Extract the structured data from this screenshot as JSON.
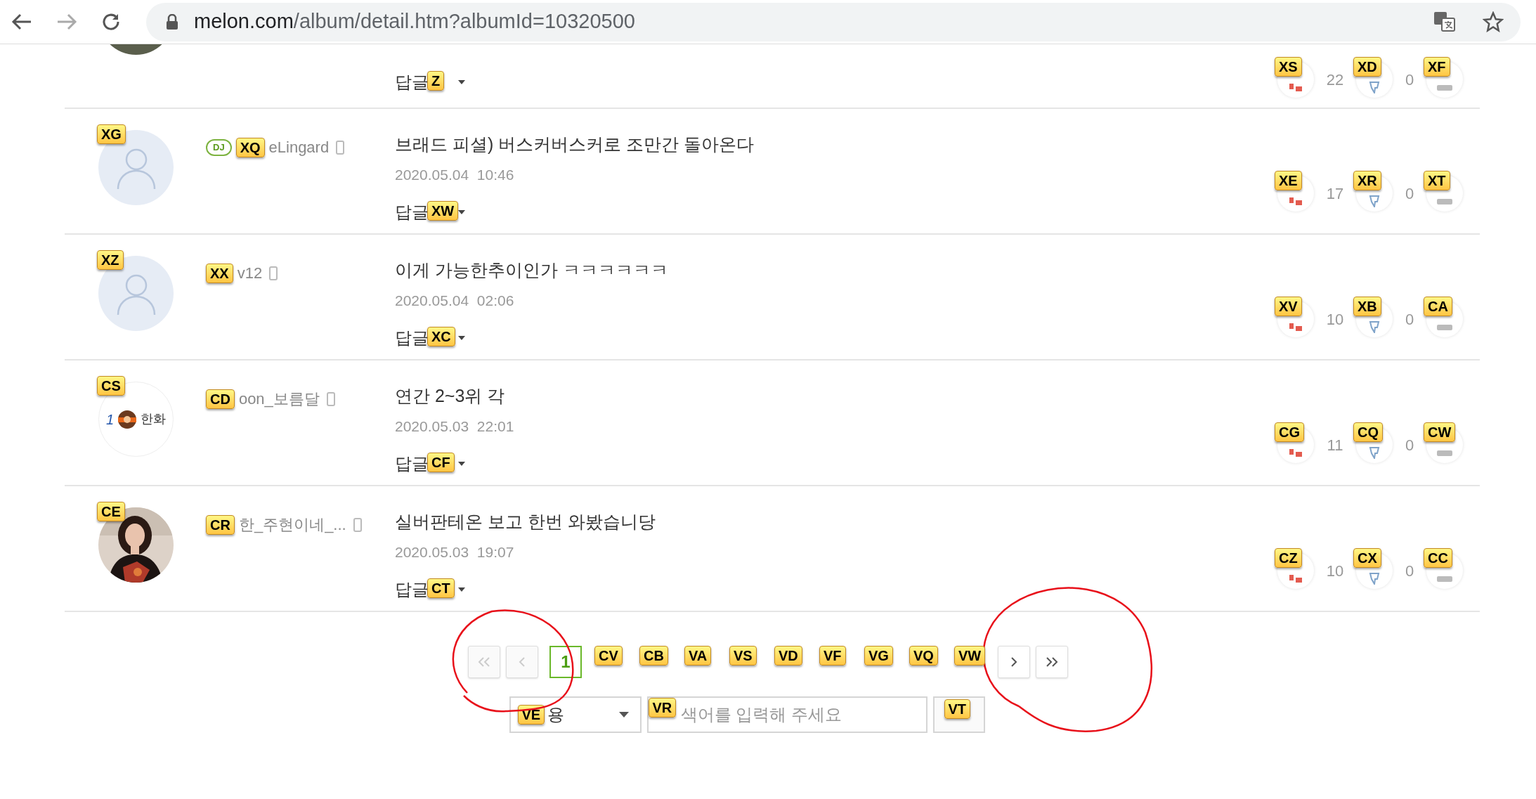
{
  "browser": {
    "url_host": "melon.com",
    "url_path": "/album/detail.htm?albumId=10320500"
  },
  "top_comment": {
    "reply": "답글",
    "hints": {
      "reply": "Z",
      "like": "XS",
      "dislike": "XD",
      "report": "XF"
    },
    "likes": "22",
    "dislikes": "0"
  },
  "comments": [
    {
      "kind": "placeholder",
      "dj": true,
      "dj_label": "DJ",
      "name": "eLingard",
      "comment": "브래드 피셜) 버스커버스커로 조만간 돌아온다",
      "date": "2020.05.04",
      "time": "10:46",
      "reply": "답글",
      "likes": "17",
      "dislikes": "0",
      "hints": {
        "avatar": "XG",
        "name": "XQ",
        "reply": "XW",
        "like": "XE",
        "dislike": "XR",
        "report": "XT"
      }
    },
    {
      "kind": "placeholder",
      "dj": false,
      "name": "v12",
      "comment": "이게 가능한추이인가 ㅋㅋㅋㅋㅋㅋ",
      "date": "2020.05.04",
      "time": "02:06",
      "reply": "답글",
      "likes": "10",
      "dislikes": "0",
      "hints": {
        "avatar": "XZ",
        "name": "XX",
        "reply": "XC",
        "like": "XV",
        "dislike": "XB",
        "report": "CA"
      }
    },
    {
      "kind": "logo",
      "avatar_texts": [
        "1",
        "한화"
      ],
      "dj": false,
      "name": "oon_보름달",
      "comment": "연간 2~3위 각",
      "date": "2020.05.03",
      "time": "22:01",
      "reply": "답글",
      "likes": "11",
      "dislikes": "0",
      "hints": {
        "avatar": "CS",
        "name": "CD",
        "reply": "CF",
        "like": "CG",
        "dislike": "CQ",
        "report": "CW"
      }
    },
    {
      "dj": false,
      "name": "한_주현이네_...",
      "comment": "실버판테온 보고 한번 와봤습니당",
      "date": "2020.05.03",
      "time": "19:07",
      "reply": "답글",
      "likes": "10",
      "dislikes": "0",
      "hints": {
        "avatar": "CE",
        "name": "CR",
        "reply": "CT",
        "like": "CZ",
        "dislike": "CX",
        "report": "CC"
      }
    }
  ],
  "pagination": {
    "pages": [
      {
        "label": "1",
        "selected": true
      },
      {
        "hint": "CV",
        "selected": false
      },
      {
        "hint": "CB",
        "selected": false
      },
      {
        "hint": "VA",
        "selected": false
      },
      {
        "hint": "VS",
        "selected": false
      },
      {
        "hint": "VD",
        "selected": false
      },
      {
        "hint": "VF",
        "selected": false
      },
      {
        "hint": "VG",
        "selected": false
      },
      {
        "hint": "VQ",
        "selected": false
      },
      {
        "hint": "VW",
        "selected": false
      }
    ]
  },
  "search": {
    "select_value": "용",
    "select_hint": "VE",
    "placeholder": "색어를 입력해 주세요",
    "input_hint": "VR",
    "button_hint": "VT"
  }
}
